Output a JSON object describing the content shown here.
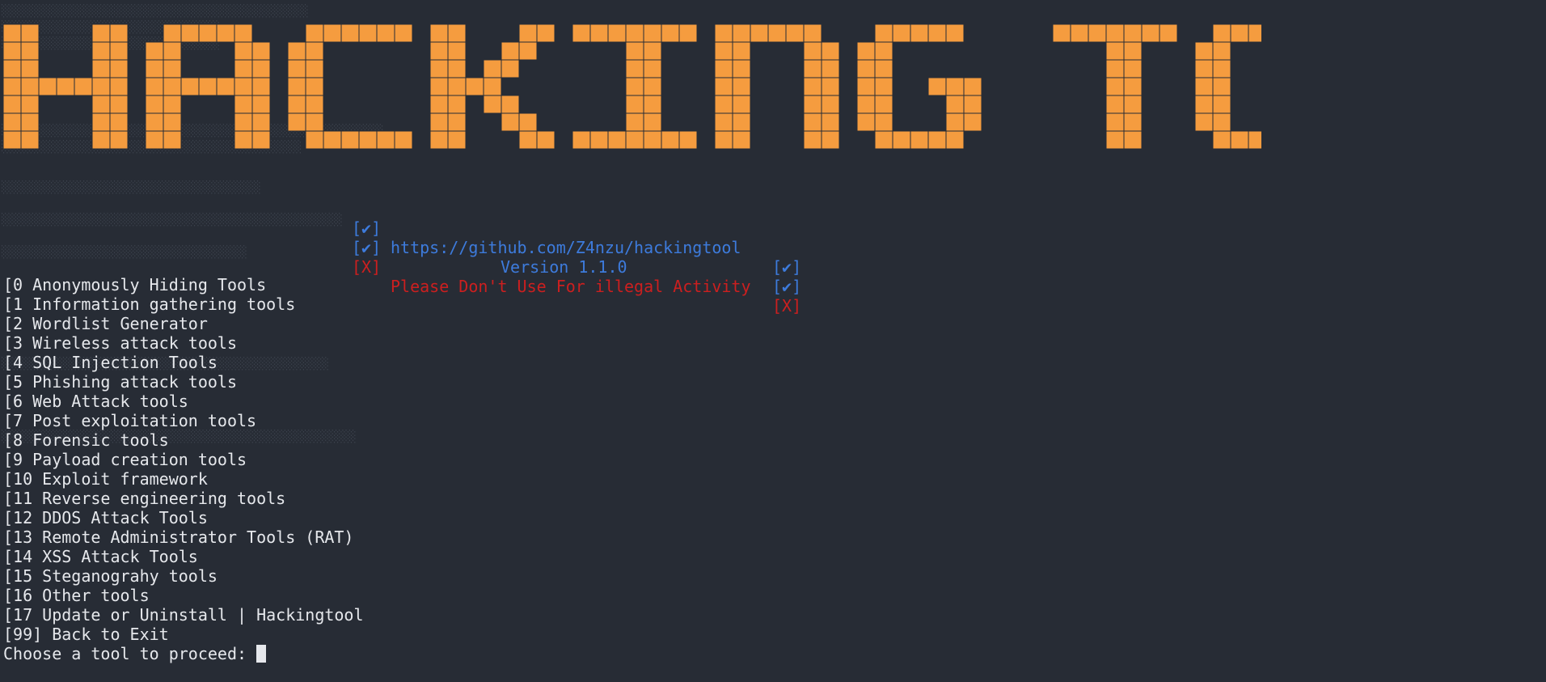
{
  "colors": {
    "banner_orange": "#f59c3f",
    "grid_line": "#272c35",
    "link_blue": "#3d7bdc",
    "warning_red": "#cc1f1f",
    "text": "#e6e8ec"
  },
  "banner": {
    "text": "HACKING TOOL"
  },
  "info": {
    "url_check": "[✔]",
    "url": "https://github.com/Z4nzu/hackingtool",
    "url_check_end": "[✔]",
    "version_check": "[✔]",
    "version": "Version 1.1.0",
    "version_check_end": "[✔]",
    "warning_mark": "[X]",
    "warning": "Please Don't Use For illegal Activity",
    "warning_mark_end": "[X]"
  },
  "menu": [
    "[0 Anonymously Hiding Tools",
    "[1 Information gathering tools",
    "[2 Wordlist Generator",
    "[3 Wireless attack tools",
    "[4 SQL Injection Tools",
    "[5 Phishing attack tools",
    "[6 Web Attack tools",
    "[7 Post exploitation tools",
    "[8 Forensic tools",
    "[9 Payload creation tools",
    "[10 Exploit framework",
    "[11 Reverse engineering tools",
    "[12 DDOS Attack Tools",
    "[13 Remote Administrator Tools (RAT)",
    "[14 XSS Attack Tools",
    "[15 Steganograhy tools",
    "[16 Other tools",
    "[17 Update or Uninstall | Hackingtool",
    "[99] Back to Exit"
  ],
  "prompt": "Choose a tool to proceed: "
}
